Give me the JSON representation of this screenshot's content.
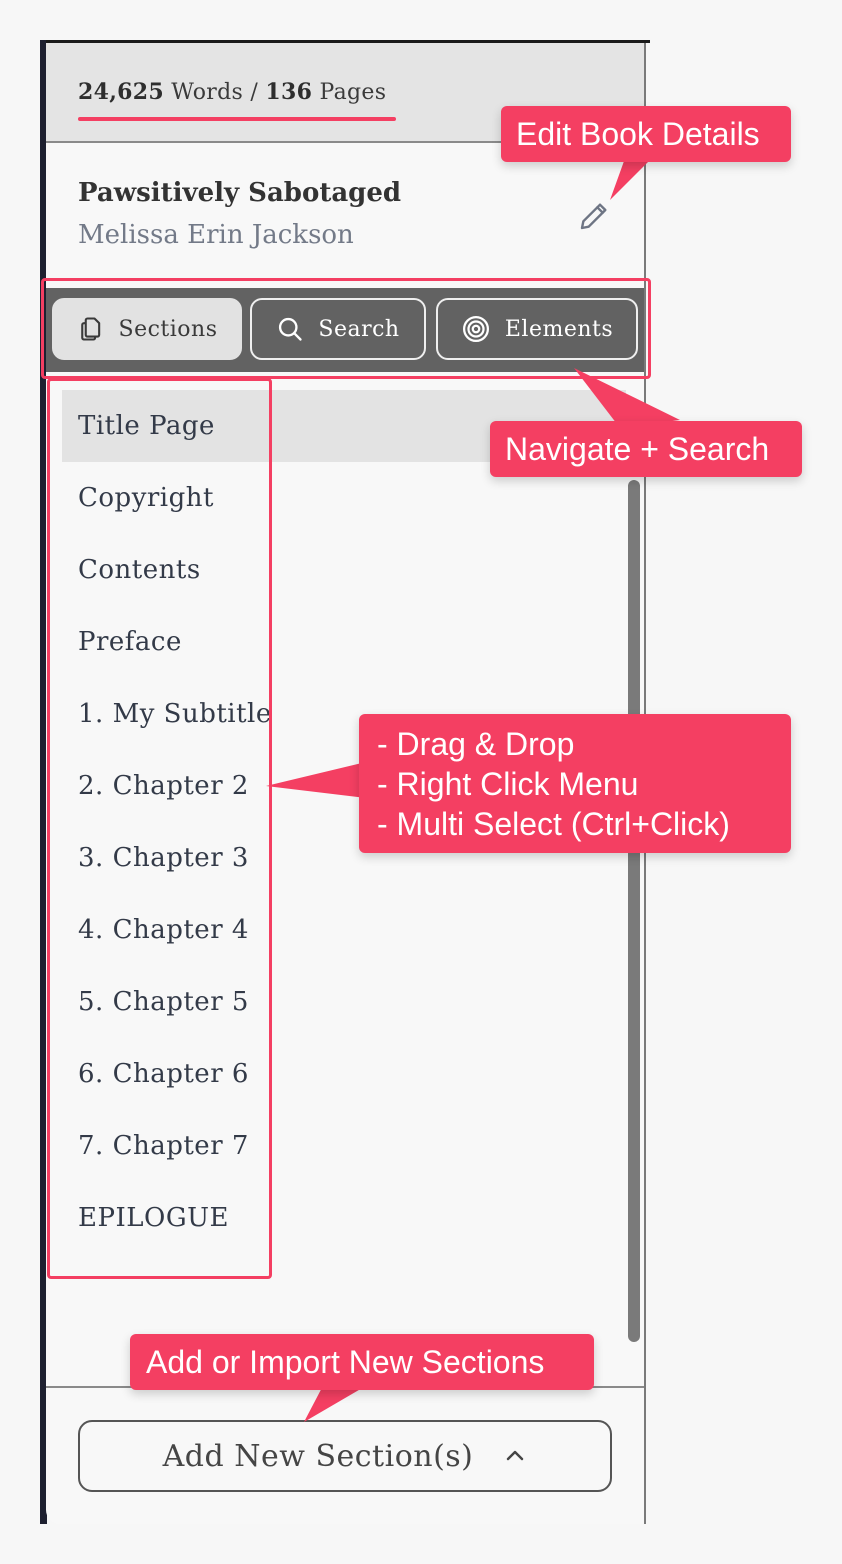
{
  "stats": {
    "words_value": "24,625",
    "words_label": "Words",
    "separator": "/",
    "pages_value": "136",
    "pages_label": "Pages"
  },
  "book": {
    "title": "Pawsitively Sabotaged",
    "author": "Melissa Erin Jackson"
  },
  "tabs": [
    {
      "label": "Sections",
      "icon": "copy-icon",
      "active": true
    },
    {
      "label": "Search",
      "icon": "search-icon",
      "active": false
    },
    {
      "label": "Elements",
      "icon": "target-icon",
      "active": false
    }
  ],
  "sections": [
    "Title Page",
    "Copyright",
    "Contents",
    "Preface",
    "1. My Subtitle",
    "2. Chapter 2",
    "3. Chapter 3",
    "4. Chapter 4",
    "5. Chapter 5",
    "6. Chapter 6",
    "7. Chapter 7",
    "EPILOGUE"
  ],
  "selected_section": "Title Page",
  "footer": {
    "add_button_label": "Add New Section(s)",
    "add_button_icon": "chevron-up-icon"
  },
  "annotations": {
    "edit_details": "Edit Book Details",
    "navigate_search": "Navigate + Search",
    "list_line1": "- Drag & Drop",
    "list_line2": "- Right Click Menu",
    "list_line3": "- Multi Select (Ctrl+Click)",
    "add_import": "Add or Import New Sections"
  },
  "colors": {
    "annotation": "#f43f62",
    "tabbar": "#626262",
    "active_tab": "#e2e2e2"
  }
}
